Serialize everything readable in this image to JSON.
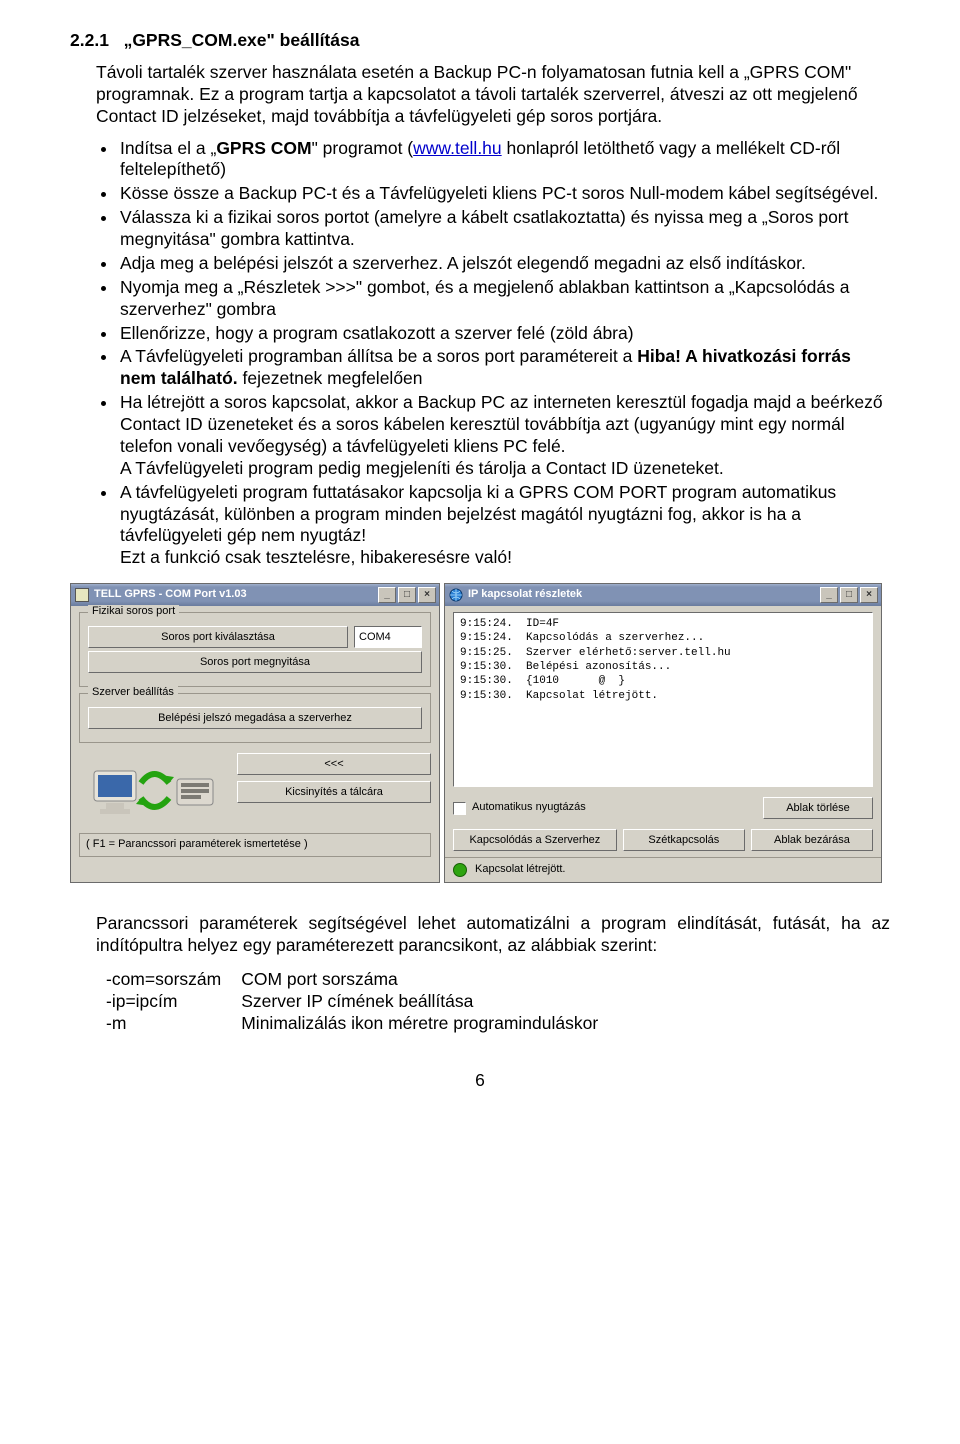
{
  "section_number": "2.2.1",
  "section_title": "„GPRS_COM.exe\" beállítása",
  "intro": "Távoli tartalék szerver használata esetén a Backup PC-n folyamatosan futnia kell a „GPRS COM\" programnak. Ez a program tartja a kapcsolatot a távoli tartalék szerverrel, átveszi az ott megjelenő Contact ID jelzéseket, majd továbbítja a távfelügyeleti gép soros portjára.",
  "bullets": {
    "b0_a": "Indítsa el a „",
    "b0_app": "GPRS COM",
    "b0_b": "\" programot (",
    "b0_link": "www.tell.hu",
    "b0_c": " honlapról letölthető vagy a mellékelt CD-ről feltelepíthető)",
    "b1": "Kösse össze a Backup PC-t és a Távfelügyeleti kliens PC-t soros Null-modem kábel segítségével.",
    "b2": "Válassza ki a fizikai soros portot (amelyre a kábelt csatlakoztatta) és nyissa meg a „Soros port megnyitása\" gombra kattintva.",
    "b3": "Adja meg a belépési jelszót a szerverhez. A jelszót elegendő megadni az első indításkor.",
    "b4": "Nyomja meg a „Részletek >>>\" gombot, és a megjelenő ablakban kattintson a „Kapcsolódás a szerverhez\" gombra",
    "b5": "Ellenőrizze, hogy a program csatlakozott a szerver felé (zöld ábra)",
    "b6_a": "A Távfelügyeleti programban állítsa be a soros port paramétereit a ",
    "b6_err1": "Hiba! A hivatkozási forrás nem található.",
    "b6_b": " fejezetnek megfelelően",
    "b7": "Ha létrejött a soros kapcsolat, akkor a Backup PC az interneten keresztül fogadja majd a beérkező Contact ID üzeneteket és a soros kábelen keresztül továbbítja azt (ugyanúgy mint egy normál telefon vonali vevőegység) a távfelügyeleti kliens PC felé.",
    "b7b": "A Távfelügyeleti program pedig megjeleníti és tárolja a Contact ID üzeneteket.",
    "b8": "A távfelügyeleti program futtatásakor kapcsolja ki a GPRS COM PORT program automatikus nyugtázását, különben a program minden bejelzést magától nyugtázni fog, akkor is ha a távfelügyeleti gép nem nyugtáz!",
    "b8b": "Ezt a funkció csak tesztelésre, hibakeresésre való!"
  },
  "win_left": {
    "title": "TELL  GPRS - COM Port v1.03",
    "group_serial": "Fizikai soros port",
    "btn_select": "Soros port kiválasztása",
    "com_value": "COM4",
    "btn_open": "Soros port megnyitása",
    "group_server": "Szerver beállítás",
    "btn_pwd": "Belépési jelszó megadása a szerverhez",
    "btn_collapse": "<<<",
    "btn_tray": "Kicsinyítés a tálcára",
    "hint": "(  F1 = Parancssori paraméterek ismertetése  )"
  },
  "win_right": {
    "title": "IP kapcsolat részletek",
    "log": "9:15:24.  ID=4F\n9:15:24.  Kapcsolódás a szerverhez...\n9:15:25.  Szerver elérhető:server.tell.hu\n9:15:30.  Belépési azonosítás...\n9:15:30.  {1010      @  }\n9:15:30.  Kapcsolat létrejött.",
    "chk_label": "Automatikus nyugtázás",
    "btn_clear": "Ablak törlése",
    "btn_connect": "Kapcsolódás a Szerverhez",
    "btn_disconnect": "Szétkapcsolás",
    "btn_close": "Ablak bezárása",
    "status": "Kapcsolat létrejött."
  },
  "closing": "Parancssori paraméterek segítségével lehet automatizálni a program elindítását, futását, ha az indítópultra helyez egy paraméterezett parancsikont, az alábbiak szerint:",
  "params": {
    "r0k": "-com=sorszám",
    "r0v": "COM port sorszáma",
    "r1k": "-ip=ipcím",
    "r1v": "Szerver IP címének beállítása",
    "r2k": "-m",
    "r2v": "Minimalizálás ikon méretre programinduláskor"
  },
  "pagenum": "6"
}
